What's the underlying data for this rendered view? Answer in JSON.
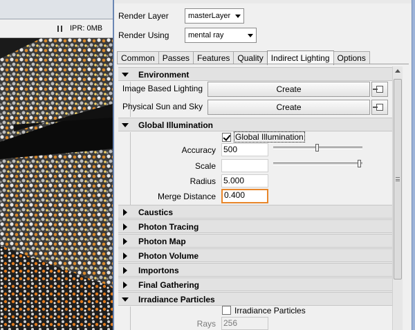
{
  "viewport": {
    "ipr_status": "IPR: 0MB"
  },
  "render_settings": {
    "render_layer_label": "Render Layer",
    "render_layer_value": "masterLayer",
    "render_using_label": "Render Using",
    "render_using_value": "mental ray",
    "tabs": [
      {
        "label": "Common",
        "active": false
      },
      {
        "label": "Passes",
        "active": false
      },
      {
        "label": "Features",
        "active": false
      },
      {
        "label": "Quality",
        "active": false
      },
      {
        "label": "Indirect Lighting",
        "active": true
      },
      {
        "label": "Options",
        "active": false
      }
    ],
    "environment": {
      "title": "Environment",
      "expanded": true,
      "image_based_lighting_label": "Image Based Lighting",
      "image_based_lighting_button": "Create",
      "physical_sun_label": "Physical Sun and Sky",
      "physical_sun_button": "Create"
    },
    "global_illumination": {
      "title": "Global Illumination",
      "expanded": true,
      "enable_label": "Global Illumination",
      "enabled": true,
      "accuracy_label": "Accuracy",
      "accuracy_value": "500",
      "accuracy_slider": 0.5,
      "scale_label": "Scale",
      "scale_value": "",
      "scale_slider": 1.0,
      "radius_label": "Radius",
      "radius_value": "5.000",
      "merge_distance_label": "Merge Distance",
      "merge_distance_value": "0.400"
    },
    "collapsed_sections": [
      "Caustics",
      "Photon Tracing",
      "Photon Map",
      "Photon Volume",
      "Importons",
      "Final Gathering"
    ],
    "irradiance_particles": {
      "title": "Irradiance Particles",
      "expanded": true,
      "enable_label": "Irradiance Particles",
      "enabled": false,
      "rays_label": "Rays",
      "rays_value": "256"
    }
  },
  "colors": {
    "active_field_border": "#e8862a",
    "window_frame": "#9db3d8"
  }
}
